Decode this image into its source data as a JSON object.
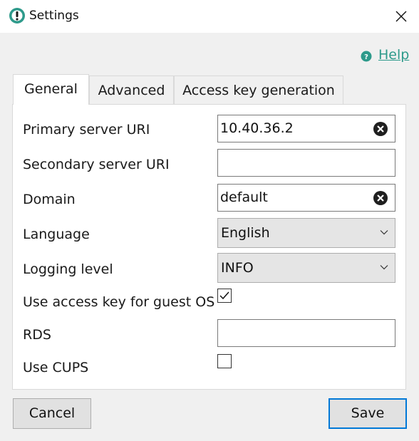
{
  "window": {
    "title": "Settings",
    "app_icon": "exclamation-circle-icon",
    "close_icon": "close-icon"
  },
  "help": {
    "label": "Help",
    "icon": "question-circle-icon"
  },
  "tabs": [
    {
      "label": "General",
      "active": true
    },
    {
      "label": "Advanced",
      "active": false
    },
    {
      "label": "Access key generation",
      "active": false
    }
  ],
  "fields": {
    "primary_server_uri": {
      "label": "Primary server URI",
      "value": "10.40.36.2"
    },
    "secondary_server_uri": {
      "label": "Secondary server URI",
      "value": ""
    },
    "domain": {
      "label": "Domain",
      "value": "default"
    },
    "language": {
      "label": "Language",
      "value": "English"
    },
    "logging_level": {
      "label": "Logging level",
      "value": "INFO"
    },
    "use_access_key": {
      "label": "Use access key for guest OS",
      "checked": true
    },
    "rds": {
      "label": "RDS",
      "value": ""
    },
    "use_cups": {
      "label": "Use CUPS",
      "checked": false
    }
  },
  "buttons": {
    "cancel": "Cancel",
    "save": "Save"
  },
  "colors": {
    "accent": "#2e9a8b",
    "primary_border": "#0078d7"
  }
}
